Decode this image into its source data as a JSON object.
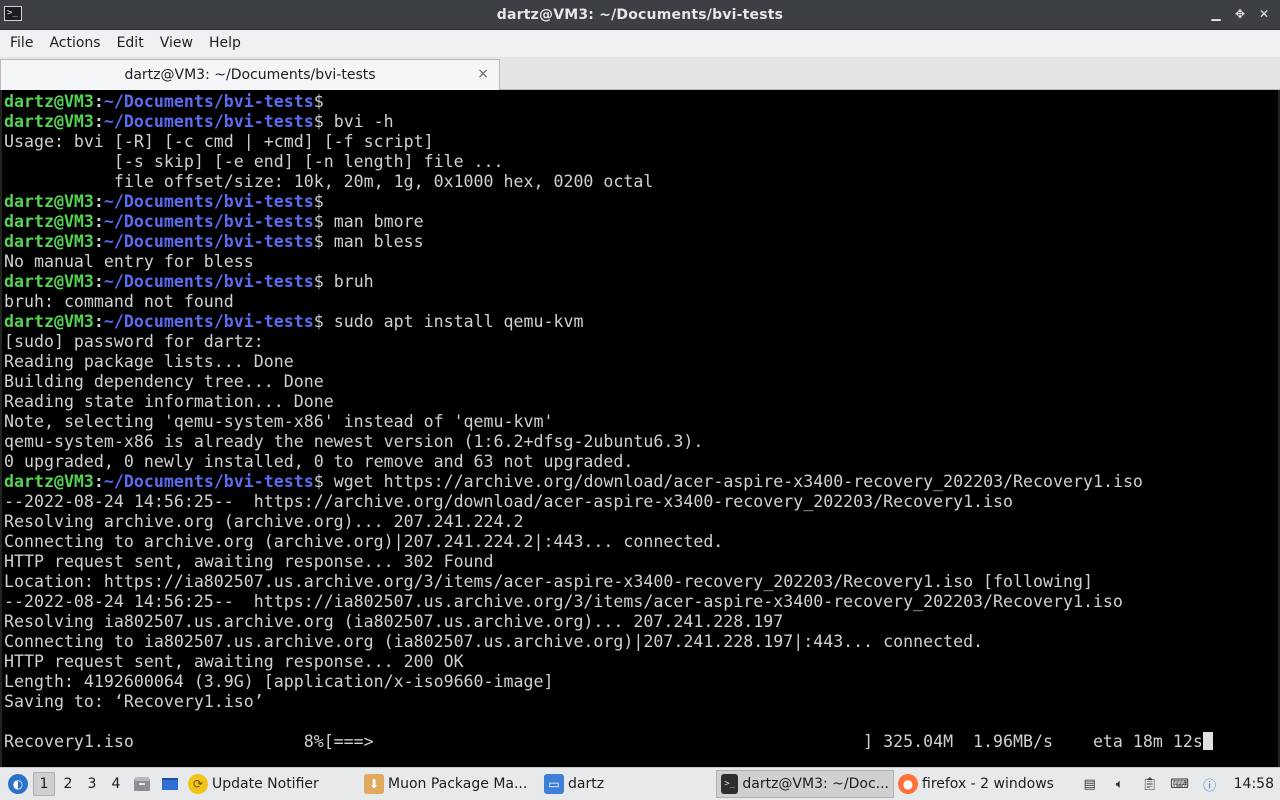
{
  "window": {
    "title": "dartz@VM3: ~/Documents/bvi-tests",
    "icon": "terminal-icon",
    "controls": [
      "minimize-icon",
      "maximize-icon",
      "close-icon"
    ]
  },
  "menubar": {
    "items": [
      "File",
      "Actions",
      "Edit",
      "View",
      "Help"
    ]
  },
  "tab": {
    "title": "dartz@VM3: ~/Documents/bvi-tests",
    "close_glyph": "×"
  },
  "prompt": {
    "user": "dartz@VM3",
    "path": "~/Documents/bvi-tests",
    "symbol": "$"
  },
  "terminal": {
    "lines": [
      {
        "prompt": true,
        "cmd": ""
      },
      {
        "prompt": true,
        "cmd": " bvi -h"
      },
      {
        "prompt": false,
        "text": "Usage: bvi [-R] [-c cmd | +cmd] [-f script]"
      },
      {
        "prompt": false,
        "text": "           [-s skip] [-e end] [-n length] file ..."
      },
      {
        "prompt": false,
        "text": "           file offset/size: 10k, 20m, 1g, 0x1000 hex, 0200 octal"
      },
      {
        "prompt": true,
        "cmd": ""
      },
      {
        "prompt": true,
        "cmd": " man bmore"
      },
      {
        "prompt": true,
        "cmd": " man bless"
      },
      {
        "prompt": false,
        "text": "No manual entry for bless"
      },
      {
        "prompt": true,
        "cmd": " bruh"
      },
      {
        "prompt": false,
        "text": "bruh: command not found"
      },
      {
        "prompt": true,
        "cmd": " sudo apt install qemu-kvm"
      },
      {
        "prompt": false,
        "text": "[sudo] password for dartz:"
      },
      {
        "prompt": false,
        "text": "Reading package lists... Done"
      },
      {
        "prompt": false,
        "text": "Building dependency tree... Done"
      },
      {
        "prompt": false,
        "text": "Reading state information... Done"
      },
      {
        "prompt": false,
        "text": "Note, selecting 'qemu-system-x86' instead of 'qemu-kvm'"
      },
      {
        "prompt": false,
        "text": "qemu-system-x86 is already the newest version (1:6.2+dfsg-2ubuntu6.3)."
      },
      {
        "prompt": false,
        "text": "0 upgraded, 0 newly installed, 0 to remove and 63 not upgraded."
      },
      {
        "prompt": true,
        "cmd": " wget https://archive.org/download/acer-aspire-x3400-recovery_202203/Recovery1.iso"
      },
      {
        "prompt": false,
        "text": "--2022-08-24 14:56:25--  https://archive.org/download/acer-aspire-x3400-recovery_202203/Recovery1.iso"
      },
      {
        "prompt": false,
        "text": "Resolving archive.org (archive.org)... 207.241.224.2"
      },
      {
        "prompt": false,
        "text": "Connecting to archive.org (archive.org)|207.241.224.2|:443... connected."
      },
      {
        "prompt": false,
        "text": "HTTP request sent, awaiting response... 302 Found"
      },
      {
        "prompt": false,
        "text": "Location: https://ia802507.us.archive.org/3/items/acer-aspire-x3400-recovery_202203/Recovery1.iso [following]"
      },
      {
        "prompt": false,
        "text": "--2022-08-24 14:56:25--  https://ia802507.us.archive.org/3/items/acer-aspire-x3400-recovery_202203/Recovery1.iso"
      },
      {
        "prompt": false,
        "text": "Resolving ia802507.us.archive.org (ia802507.us.archive.org)... 207.241.228.197"
      },
      {
        "prompt": false,
        "text": "Connecting to ia802507.us.archive.org (ia802507.us.archive.org)|207.241.228.197|:443... connected."
      },
      {
        "prompt": false,
        "text": "HTTP request sent, awaiting response... 200 OK"
      },
      {
        "prompt": false,
        "text": "Length: 4192600064 (3.9G) [application/x-iso9660-image]"
      },
      {
        "prompt": false,
        "text": "Saving to: ‘Recovery1.iso’"
      },
      {
        "prompt": false,
        "text": ""
      },
      {
        "prompt": false,
        "text": "Recovery1.iso                 8%[===>                                                 ] 325.04M  1.96MB/s    eta 18m 12s",
        "cursor": true
      }
    ]
  },
  "taskbar": {
    "start_icon": "lubuntu-start-icon",
    "desktops": [
      "1",
      "2",
      "3",
      "4"
    ],
    "active_desktop": "1",
    "quick_launch": [
      "file-manager-icon",
      "show-desktop-icon"
    ],
    "tasks": [
      {
        "label": "Update Notifier",
        "icon": "update-notifier-icon",
        "active": false
      },
      {
        "label": "Muon Package Ma...",
        "icon": "muon-package-icon",
        "active": false
      },
      {
        "label": "dartz",
        "icon": "folder-icon",
        "active": false
      },
      {
        "label": "dartz@VM3: ~/Doc...",
        "icon": "terminal-icon",
        "active": true
      },
      {
        "label": "firefox - 2 windows",
        "icon": "firefox-icon",
        "active": false
      }
    ],
    "tray": [
      "network-icon",
      "volume-icon",
      "clipboard-icon",
      "keyboard-icon",
      "notification-icon"
    ],
    "clock": "14:58"
  }
}
